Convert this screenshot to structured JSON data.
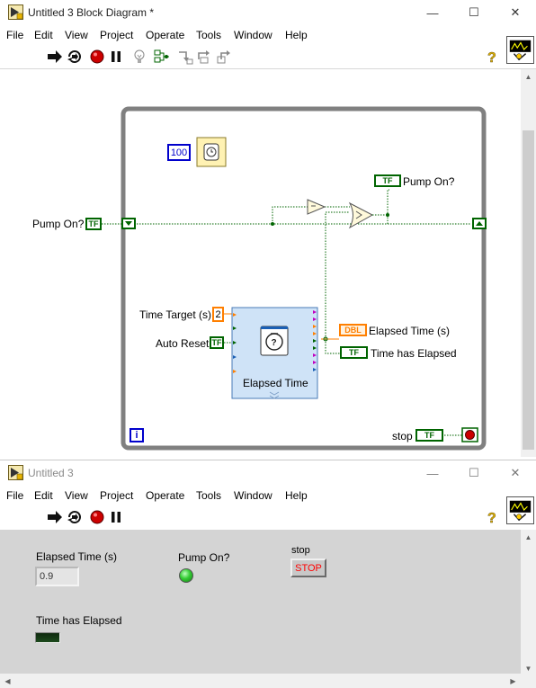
{
  "block_diagram": {
    "title": "Untitled 3 Block Diagram *",
    "menu": [
      "File",
      "Edit",
      "View",
      "Project",
      "Operate",
      "Tools",
      "Window",
      "Help"
    ],
    "diagram": {
      "wait_constant": "100",
      "pump_on_control_label": "Pump On?",
      "pump_on_control_glyph": "TF",
      "pump_on_indicator_label": "Pump On?",
      "pump_on_indicator_glyph": "TF",
      "time_target_label": "Time Target (s)",
      "time_target_value": "2",
      "auto_reset_label": "Auto Reset",
      "auto_reset_glyph": "TF",
      "express_vi_label": "Elapsed Time",
      "elapsed_time_indicator_label": "Elapsed Time (s)",
      "elapsed_time_indicator_glyph": "DBL",
      "time_elapsed_indicator_label": "Time has Elapsed",
      "time_elapsed_indicator_glyph": "TF",
      "stop_label": "stop",
      "stop_glyph": "TF",
      "iteration_glyph": "i"
    }
  },
  "front_panel": {
    "title": "Untitled 3",
    "menu": [
      "File",
      "Edit",
      "View",
      "Project",
      "Operate",
      "Tools",
      "Window",
      "Help"
    ],
    "elapsed_time_label": "Elapsed Time (s)",
    "elapsed_time_value": "0.9",
    "pump_on_label": "Pump On?",
    "stop_label": "stop",
    "stop_button_text": "STOP",
    "time_elapsed_label": "Time has Elapsed"
  },
  "colors": {
    "boolean_wire": "#006400",
    "numeric_double": "#ff7f00",
    "numeric_integer": "#0000cc",
    "while_loop": "#808080",
    "express_vi_bg": "#cfe3f7",
    "led_on": "#33cc33",
    "stop_text": "#ff0000"
  }
}
